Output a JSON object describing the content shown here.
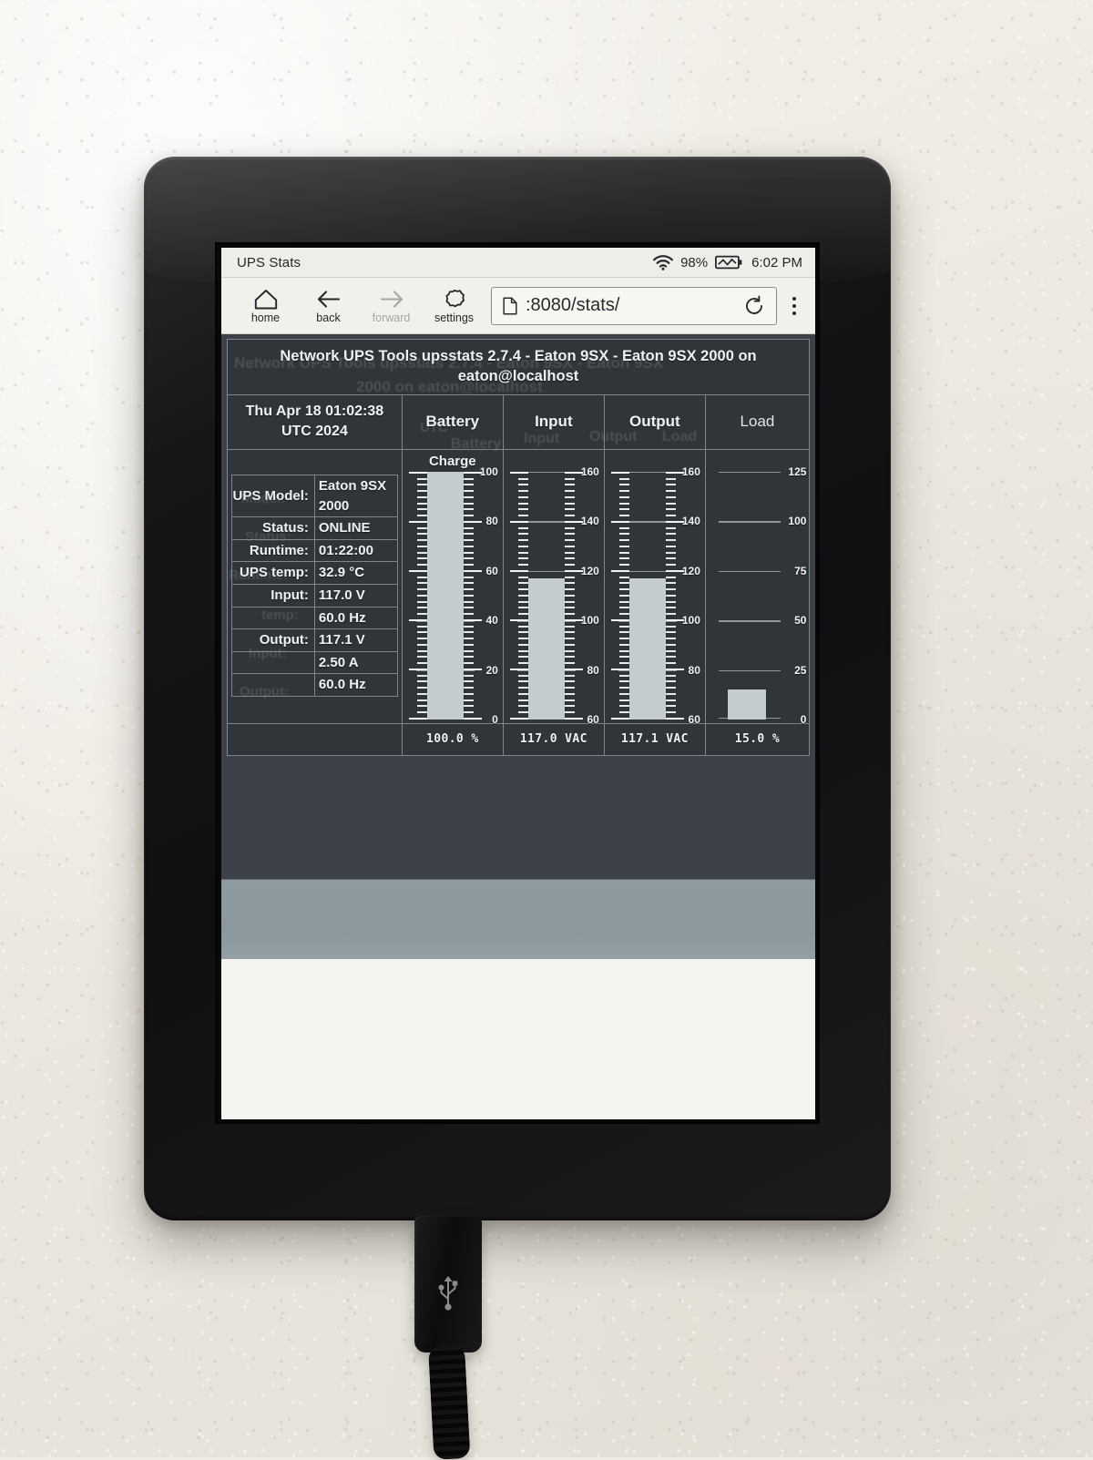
{
  "device": {
    "status_bar": {
      "title": "UPS Stats",
      "wifi_icon": "wifi-icon",
      "battery_percent": "98%",
      "battery_icon": "battery-charging-icon",
      "time": "6:02 PM"
    },
    "toolbar": {
      "buttons": [
        {
          "label": "home",
          "icon": "home-icon",
          "enabled": true
        },
        {
          "label": "back",
          "icon": "arrow-left-icon",
          "enabled": true
        },
        {
          "label": "forward",
          "icon": "arrow-right-icon",
          "enabled": false
        },
        {
          "label": "settings",
          "icon": "gear-icon",
          "enabled": true
        }
      ],
      "url": ":8080/stats/",
      "page_icon": "document-icon",
      "reload_icon": "reload-icon",
      "menu_icon": "overflow-menu-icon"
    },
    "usb": {
      "icon": "usb-icon"
    }
  },
  "page": {
    "title": "Network UPS Tools upsstats 2.7.4 - Eaton 9SX - Eaton 9SX 2000 on eaton@localhost",
    "timestamp": "Thu Apr 18 01:02:38 UTC 2024",
    "columns": [
      "Battery",
      "Input",
      "Output",
      "Load"
    ],
    "info": [
      {
        "key": "UPS Model:",
        "value": "Eaton 9SX 2000"
      },
      {
        "key": "Status:",
        "value": "ONLINE"
      },
      {
        "key": "Runtime:",
        "value": "01:22:00"
      },
      {
        "key": "UPS temp:",
        "value": "32.9 °C"
      },
      {
        "key": "Input:",
        "value": "117.0 V"
      },
      {
        "key": "",
        "value": "60.0 Hz"
      },
      {
        "key": "Output:",
        "value": "117.1 V"
      },
      {
        "key": "",
        "value": "2.50 A"
      },
      {
        "key": "",
        "value": "60.0 Hz"
      }
    ],
    "gauge_titles": {
      "battery": "Charge",
      "input": "",
      "output": "",
      "load": ""
    },
    "values": {
      "battery": "100.0 %",
      "input": "117.0 VAC",
      "output": "117.1 VAC",
      "load": "15.0 %"
    },
    "ghost_text": [
      "Network UPS Tools upsstats 2.7.4 - Eaton 9SX - Eaton 9SX",
      "2000 on eaton@localhost",
      "UTC",
      "Battery",
      "Input",
      "Output",
      "Load",
      "Model:",
      "Status:",
      "Runtime:",
      "temp:",
      "Input:",
      "Output:"
    ]
  },
  "chart_data": [
    {
      "type": "bar",
      "title": "Charge",
      "categories": [
        "Battery"
      ],
      "values": [
        100.0
      ],
      "unit": "%",
      "value_label": "100.0 %",
      "ylim": [
        0,
        100
      ],
      "yticks": [
        0,
        20,
        40,
        60,
        80,
        100
      ],
      "ylabel": "",
      "grid": true
    },
    {
      "type": "bar",
      "title": "Input",
      "categories": [
        "Input"
      ],
      "values": [
        117.0
      ],
      "unit": "VAC",
      "value_label": "117.0 VAC",
      "ylim": [
        60,
        160
      ],
      "yticks": [
        60,
        80,
        100,
        120,
        140,
        160
      ],
      "ylabel": "",
      "grid": true
    },
    {
      "type": "bar",
      "title": "Output",
      "categories": [
        "Output"
      ],
      "values": [
        117.1
      ],
      "unit": "VAC",
      "value_label": "117.1 VAC",
      "ylim": [
        60,
        160
      ],
      "yticks": [
        60,
        80,
        100,
        120,
        140,
        160
      ],
      "ylabel": "",
      "grid": true
    },
    {
      "type": "bar",
      "title": "Load",
      "categories": [
        "Load"
      ],
      "values": [
        15.0
      ],
      "unit": "%",
      "value_label": "15.0 %",
      "ylim": [
        0,
        125
      ],
      "yticks": [
        0,
        25,
        50,
        75,
        100,
        125
      ],
      "ylabel": "",
      "grid": true
    }
  ]
}
